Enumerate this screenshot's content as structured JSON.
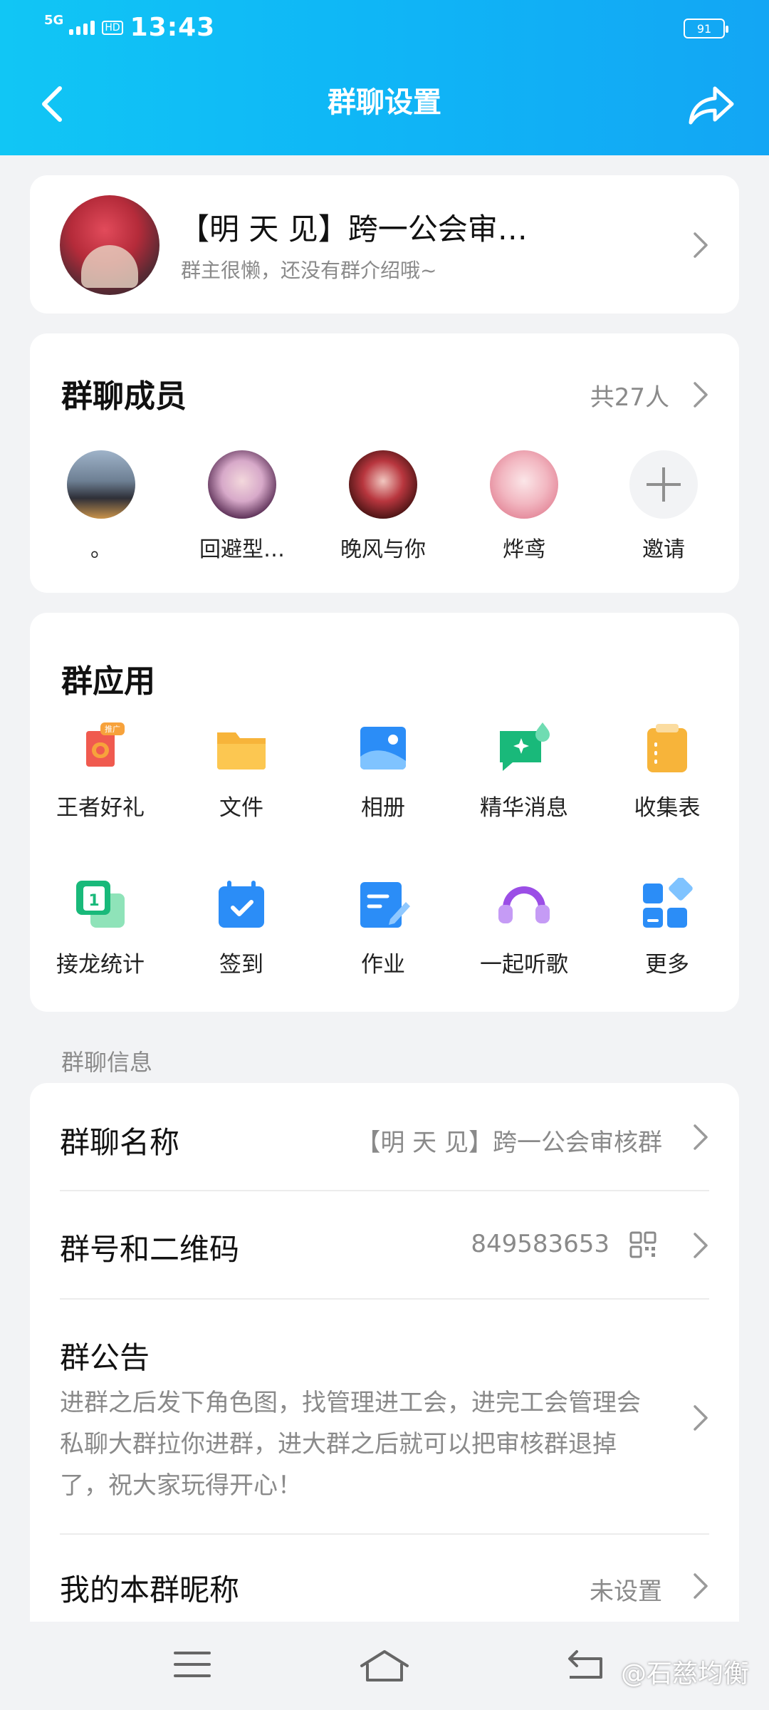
{
  "status": {
    "time": "13:43",
    "network": "5G",
    "hd": "HD",
    "battery": "91"
  },
  "header": {
    "title": "群聊设置"
  },
  "group": {
    "name": "【明 天 见】跨一公会审…",
    "description": "群主很懒，还没有群介绍哦~"
  },
  "members": {
    "title": "群聊成员",
    "count": "共27人",
    "list": [
      {
        "name": "。"
      },
      {
        "name": "回避型…"
      },
      {
        "name": "晚风与你"
      },
      {
        "name": "烨鸢"
      }
    ],
    "invite_label": "邀请"
  },
  "apps": {
    "title": "群应用",
    "badge": "推广",
    "items": [
      {
        "label": "王者好礼",
        "icon": "gift-icon"
      },
      {
        "label": "文件",
        "icon": "folder-icon"
      },
      {
        "label": "相册",
        "icon": "album-icon"
      },
      {
        "label": "精华消息",
        "icon": "essence-icon"
      },
      {
        "label": "收集表",
        "icon": "clipboard-icon"
      },
      {
        "label": "接龙统计",
        "icon": "relay-icon"
      },
      {
        "label": "签到",
        "icon": "checkin-icon"
      },
      {
        "label": "作业",
        "icon": "homework-icon"
      },
      {
        "label": "一起听歌",
        "icon": "music-icon"
      },
      {
        "label": "更多",
        "icon": "more-grid-icon"
      }
    ]
  },
  "info": {
    "caption": "群聊信息",
    "name_label": "群聊名称",
    "name_value": "【明 天 见】跨一公会审核群",
    "number_label": "群号和二维码",
    "number_value": "849583653",
    "notice_label": "群公告",
    "notice_text": "进群之后发下角色图，找管理进工会，进完工会管理会私聊大群拉你进群，进大群之后就可以把审核群退掉了，祝大家玩得开心！",
    "nickname_label": "我的本群昵称",
    "nickname_value": "未设置"
  },
  "watermark": "@石慈均衡",
  "colors": {
    "accent": "#12b4f5",
    "text": "#111111",
    "muted": "#8a8a8a"
  }
}
